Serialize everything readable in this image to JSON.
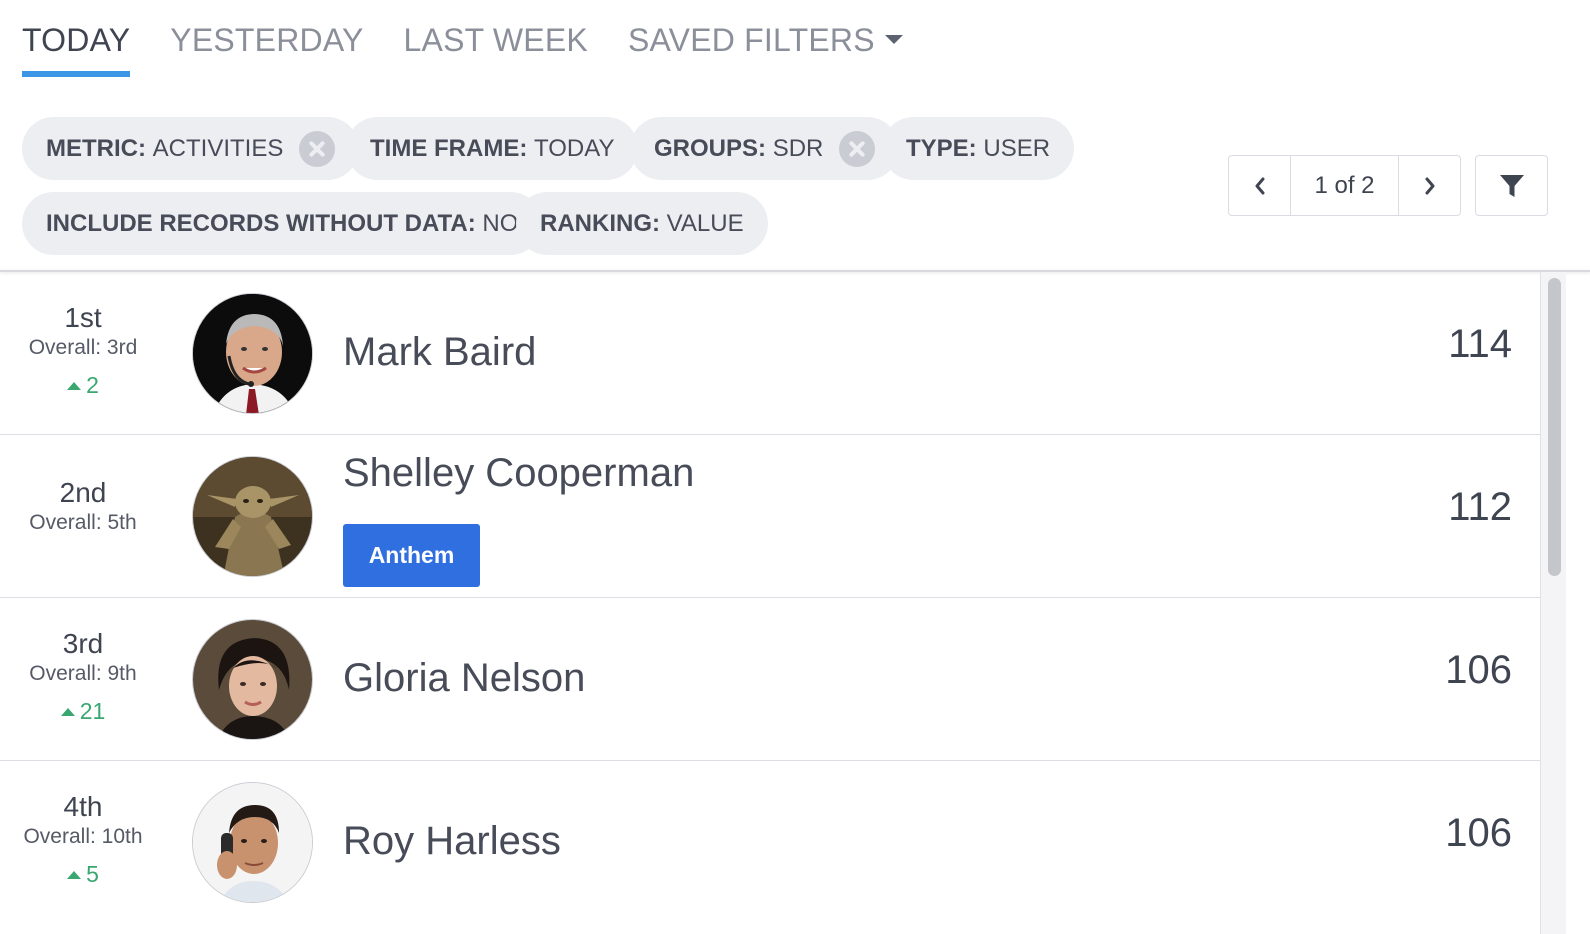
{
  "tabs": [
    {
      "label": "TODAY",
      "active": true
    },
    {
      "label": "YESTERDAY",
      "active": false
    },
    {
      "label": "LAST WEEK",
      "active": false
    },
    {
      "label": "SAVED FILTERS",
      "active": false,
      "icon": "caret-down-icon"
    }
  ],
  "filters": [
    {
      "key": "METRIC:",
      "value": "ACTIVITIES",
      "removable": true
    },
    {
      "key": "TIME FRAME:",
      "value": "TODAY",
      "removable": false
    },
    {
      "key": "GROUPS:",
      "value": "SDR",
      "removable": true
    },
    {
      "key": "TYPE:",
      "value": "USER",
      "removable": false
    },
    {
      "key": "INCLUDE RECORDS WITHOUT DATA:",
      "value": "NO",
      "removable": false
    },
    {
      "key": "RANKING:",
      "value": "VALUE",
      "removable": false
    }
  ],
  "pager": {
    "label": "1 of 2",
    "prev_icon": "chevron-left-icon",
    "next_icon": "chevron-right-icon"
  },
  "filter_button_icon": "funnel-icon",
  "colors": {
    "accent": "#3b97e6",
    "up": "#3aa771",
    "badge": "#2f6fe0",
    "chip_bg": "#eceef2"
  },
  "rows": [
    {
      "rank": "1st",
      "overall": "Overall: 3rd",
      "delta": "2",
      "name": "Mark Baird",
      "score": "114",
      "badge": ""
    },
    {
      "rank": "2nd",
      "overall": "Overall: 5th",
      "delta": "",
      "name": "Shelley Cooperman",
      "score": "112",
      "badge": "Anthem"
    },
    {
      "rank": "3rd",
      "overall": "Overall: 9th",
      "delta": "21",
      "name": "Gloria Nelson",
      "score": "106",
      "badge": ""
    },
    {
      "rank": "4th",
      "overall": "Overall: 10th",
      "delta": "5",
      "name": "Roy Harless",
      "score": "106",
      "badge": ""
    }
  ]
}
